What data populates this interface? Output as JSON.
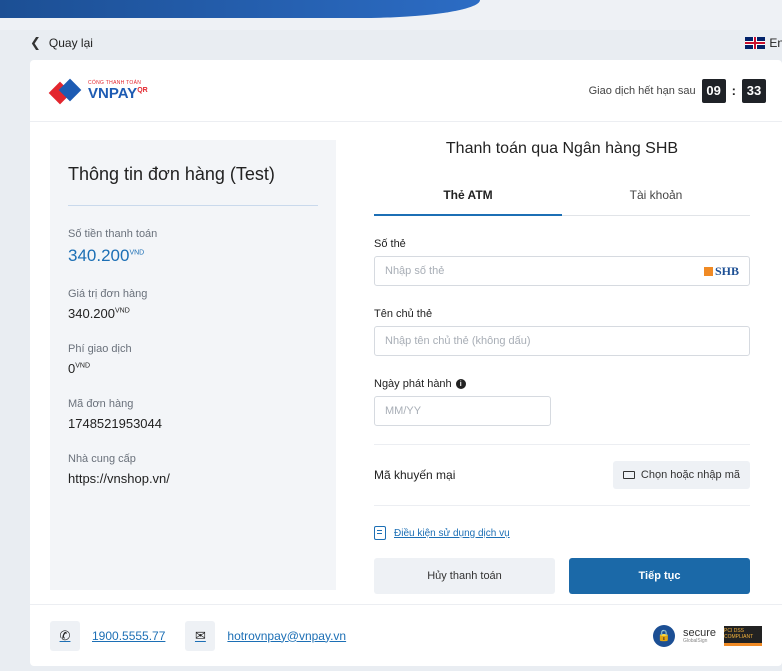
{
  "topbar": {
    "back_label": "Quay lại",
    "language_label": "En",
    "language_icon": "uk-flag-icon"
  },
  "header": {
    "logo_small": "CỔNG THANH TOÁN",
    "logo_big": "VNPAY",
    "logo_qr": "QR",
    "expiry_label": "Giao dịch hết hạn sau",
    "timer_minutes": "09",
    "timer_seconds": "33"
  },
  "order": {
    "title": "Thông tin đơn hàng (Test)",
    "amount_label": "Số tiền thanh toán",
    "amount_value": "340.200",
    "order_value_label": "Giá trị đơn hàng",
    "order_value": "340.200",
    "fee_label": "Phí giao dịch",
    "fee_value": "0",
    "order_id_label": "Mã đơn hàng",
    "order_id": "1748521953044",
    "provider_label": "Nhà cung cấp",
    "provider": "https://vnshop.vn/",
    "currency": "VND"
  },
  "payment": {
    "title": "Thanh toán qua Ngân hàng SHB",
    "tabs": [
      {
        "label": "Thẻ ATM",
        "active": true
      },
      {
        "label": "Tài khoản",
        "active": false
      }
    ],
    "card_number_label": "Số thẻ",
    "card_number_placeholder": "Nhập số thẻ",
    "bank_logo": "SHB",
    "card_holder_label": "Tên chủ thẻ",
    "card_holder_placeholder": "Nhập tên chủ thẻ (không dấu)",
    "issue_date_label": "Ngày phát hành",
    "issue_date_placeholder": "MM/YY",
    "promo_label": "Mã khuyến mại",
    "promo_button": "Chọn hoặc nhập mã",
    "terms_link": "Điều kiện sử dụng dịch vụ",
    "cancel_button": "Hủy thanh toán",
    "continue_button": "Tiếp tục"
  },
  "footer": {
    "phone": "1900.5555.77",
    "email": "hotrovnpay@vnpay.vn",
    "secure_label": "secure",
    "secure_sub": "GlobalSign",
    "pci_label": "PCI DSS COMPLIANT"
  },
  "colors": {
    "accent": "#1c6fb5",
    "primary_button": "#1b69a8",
    "brand_red": "#e3262e",
    "brand_blue": "#1d5bb3"
  }
}
